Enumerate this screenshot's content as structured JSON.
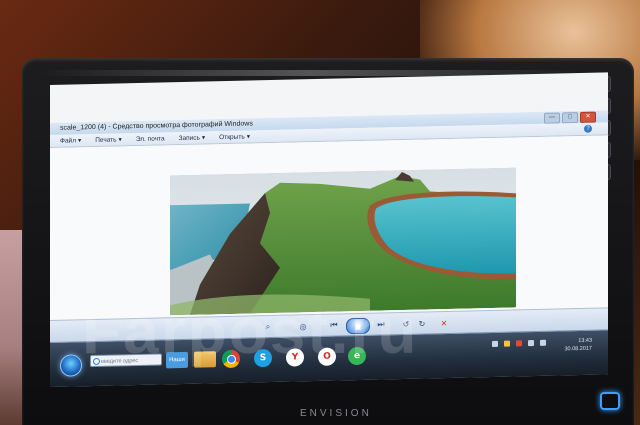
{
  "window": {
    "title": "scale_1200 (4) - Средство просмотра фотографий Windows",
    "min_label": "—",
    "max_label": "□",
    "close_label": "✕"
  },
  "menu": {
    "items": [
      {
        "label": "Файл",
        "arrow": "▾"
      },
      {
        "label": "Печать",
        "arrow": "▾"
      },
      {
        "label": "Эл. почта",
        "arrow": ""
      },
      {
        "label": "Запись",
        "arrow": "▾"
      },
      {
        "label": "Открыть",
        "arrow": "▾"
      }
    ],
    "help": "?"
  },
  "controls": {
    "zoom": "⌕",
    "fit": "◎",
    "prev": "⏮",
    "play": "▣",
    "next": "⏭",
    "rotate_left": "↺",
    "rotate_right": "↻",
    "delete": "✕"
  },
  "taskbar": {
    "search_placeholder": "введите адрес",
    "tile_1": "Наши",
    "tile_2": "",
    "apps": {
      "skype": "S",
      "yandex": "Y",
      "opera": "O",
      "edge": "e"
    },
    "clock_time": "13:43",
    "clock_date": "30.08.2017"
  },
  "monitor": {
    "brand": "ENVISION"
  },
  "watermark": "Farpost.ru",
  "icons": {
    "side_buttons": [
      "screen-icon",
      "menu-icon",
      "gear-icon",
      "down-icon",
      "up-icon"
    ]
  }
}
